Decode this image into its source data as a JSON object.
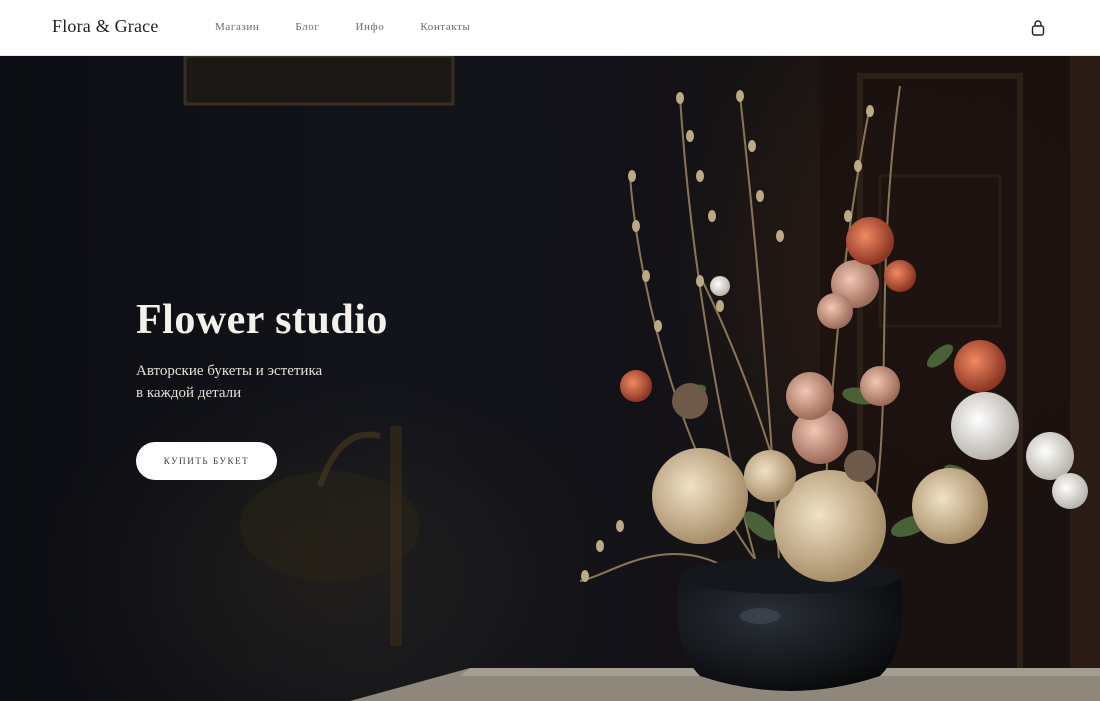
{
  "header": {
    "logo": "Flora & Grace",
    "nav": [
      "Магазин",
      "Блог",
      "Инфо",
      "Контакты"
    ],
    "cart_icon": "shopping-bag-icon"
  },
  "hero": {
    "title": "Flower studio",
    "subtitle_lines": [
      "Авторские букеты и эстетика",
      "в каждой детали"
    ],
    "cta_label": "КУПИТЬ БУКЕТ"
  },
  "colors": {
    "header_bg": "#ffffff",
    "hero_bg": "#0d0e12",
    "text_light": "#f4f1ea",
    "button_bg": "#ffffff"
  }
}
